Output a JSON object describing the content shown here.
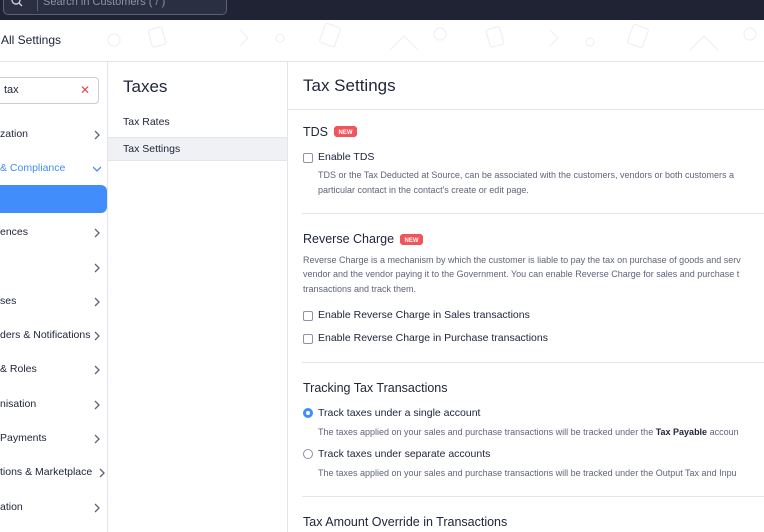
{
  "topbar": {
    "search_placeholder": "Search in Customers ( / )",
    "search_icon": "search-icon"
  },
  "header": {
    "title": "All Settings"
  },
  "leftnav": {
    "filter_value": "tax",
    "clear_icon": "✕",
    "items": [
      {
        "label": "zation",
        "state": "normal"
      },
      {
        "label": "& Compliance",
        "state": "expanded"
      },
      {
        "label": "",
        "state": "active"
      },
      {
        "label": "ences",
        "state": "normal"
      },
      {
        "label": "",
        "state": "normal"
      },
      {
        "label": "ses",
        "state": "normal"
      },
      {
        "label": "ders & Notifications",
        "state": "normal"
      },
      {
        "label": "& Roles",
        "state": "normal"
      },
      {
        "label": "nisation",
        "state": "normal"
      },
      {
        "label": "Payments",
        "state": "normal"
      },
      {
        "label": "tions & Marketplace",
        "state": "normal"
      },
      {
        "label": "ation",
        "state": "normal"
      }
    ]
  },
  "midpanel": {
    "title": "Taxes",
    "items": [
      {
        "label": "Tax Rates",
        "selected": false
      },
      {
        "label": "Tax Settings",
        "selected": true
      }
    ]
  },
  "main": {
    "title": "Tax Settings",
    "tds": {
      "title": "TDS",
      "badge": "NEW",
      "enable_label": "Enable TDS",
      "enable_checked": false,
      "desc_line1": "TDS or the Tax Deducted at Source, can be associated with the customers, vendors or both customers a",
      "desc_line2": "particular contact in the contact's create or edit page."
    },
    "reverse_charge": {
      "title": "Reverse Charge",
      "badge": "NEW",
      "desc_line1": "Reverse Charge is a mechanism by which the customer is liable to pay the tax on purchase of goods and serv",
      "desc_line2": "vendor and the vendor paying it to the Government. You can enable Reverse Charge for sales and purchase t",
      "desc_line3": "transactions and track them.",
      "sales_label": "Enable Reverse Charge in Sales transactions",
      "sales_checked": false,
      "purchase_label": "Enable Reverse Charge in Purchase transactions",
      "purchase_checked": false
    },
    "tracking": {
      "title": "Tracking Tax Transactions",
      "single_label": "Track taxes under a single account",
      "single_selected": true,
      "single_desc_pre": "The taxes applied on your sales and purchase transactions will be tracked under the ",
      "single_desc_bold": "Tax Payable",
      "single_desc_post": " accoun",
      "separate_label": "Track taxes under separate accounts",
      "separate_selected": false,
      "separate_desc": "The taxes applied on your sales and purchase transactions will be tracked under the Output Tax and Inpu"
    },
    "override": {
      "title": "Tax Amount Override in Transactions"
    }
  },
  "colors": {
    "accent": "#408dfb",
    "topbar": "#1f2333",
    "badge": "#f0545c",
    "clear": "#e04848"
  }
}
